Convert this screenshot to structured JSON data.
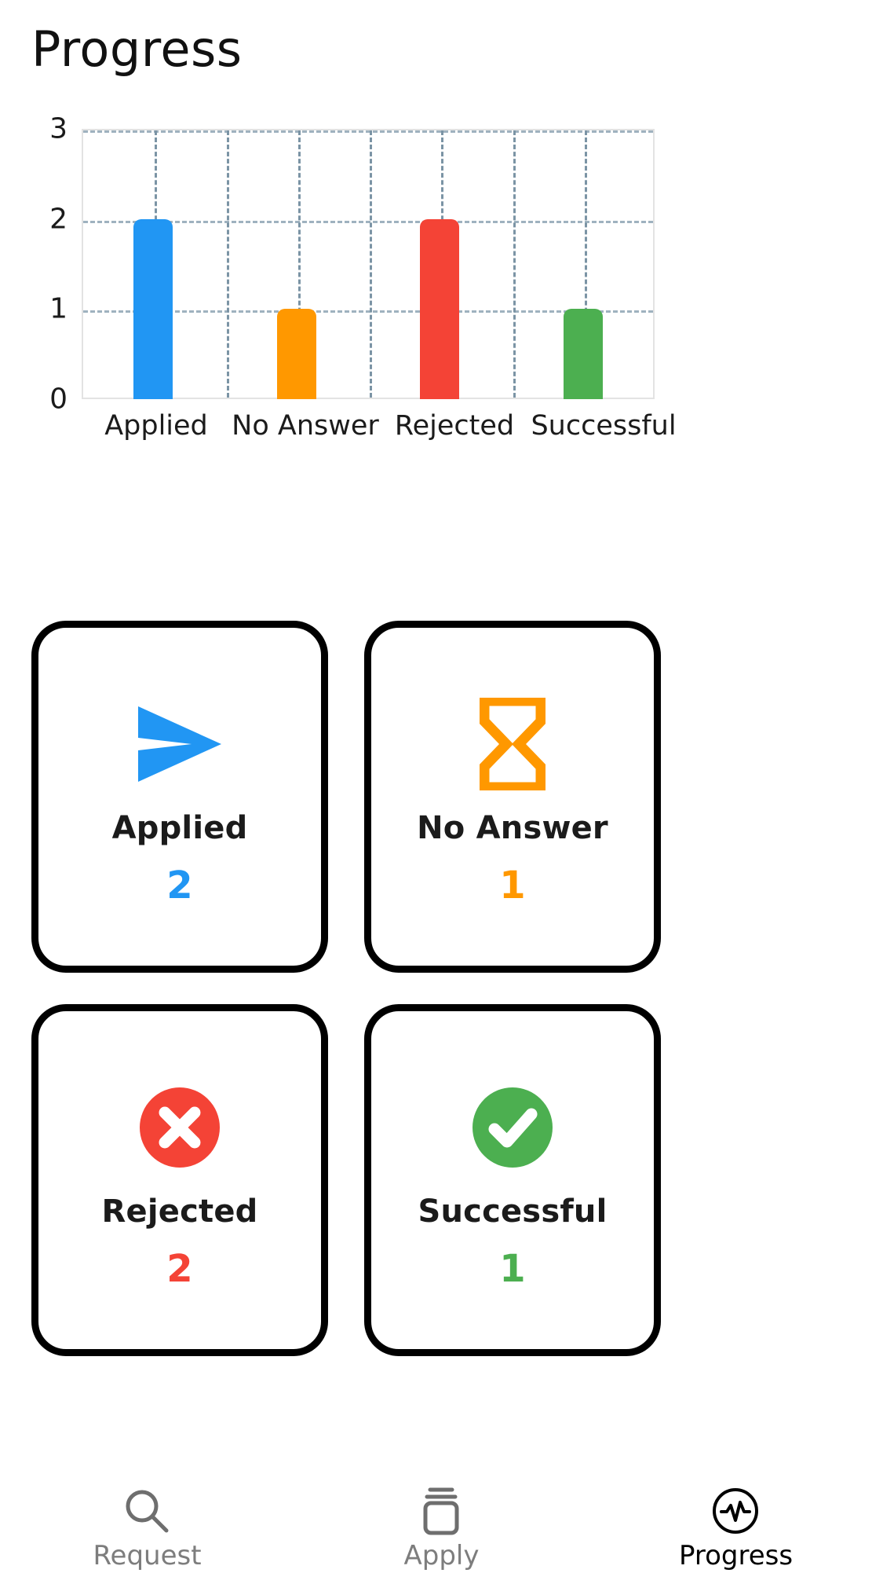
{
  "header": {
    "title": "Progress"
  },
  "chart_data": {
    "type": "bar",
    "title": "",
    "xlabel": "",
    "ylabel": "",
    "categories": [
      "Applied",
      "No Answer",
      "Rejected",
      "Successful"
    ],
    "values": [
      2,
      1,
      2,
      1
    ],
    "colors": [
      "#2196F3",
      "#FF9800",
      "#F44336",
      "#4CAF50"
    ],
    "ylim": [
      0,
      3
    ],
    "yticks": [
      "0",
      "1",
      "2",
      "3"
    ],
    "ytick_values": [
      0,
      1,
      2,
      3
    ],
    "grid": true,
    "legend": "none",
    "gridline_color": "#9fb2bf",
    "plot_border_color": "#e3e3e3"
  },
  "cards": [
    {
      "label": "Applied",
      "value": "2",
      "color": "#2196F3",
      "icon": "send-icon"
    },
    {
      "label": "No Answer",
      "value": "1",
      "color": "#FF9800",
      "icon": "hourglass-icon"
    },
    {
      "label": "Rejected",
      "value": "2",
      "color": "#F44336",
      "icon": "circle-x-icon"
    },
    {
      "label": "Successful",
      "value": "1",
      "color": "#4CAF50",
      "icon": "circle-check-icon"
    }
  ],
  "bottom_nav": {
    "items": [
      {
        "label": "Request",
        "icon": "search-icon",
        "active": false
      },
      {
        "label": "Apply",
        "icon": "cards-stack-icon",
        "active": false
      },
      {
        "label": "Progress",
        "icon": "activity-circle-icon",
        "active": true
      }
    ]
  }
}
